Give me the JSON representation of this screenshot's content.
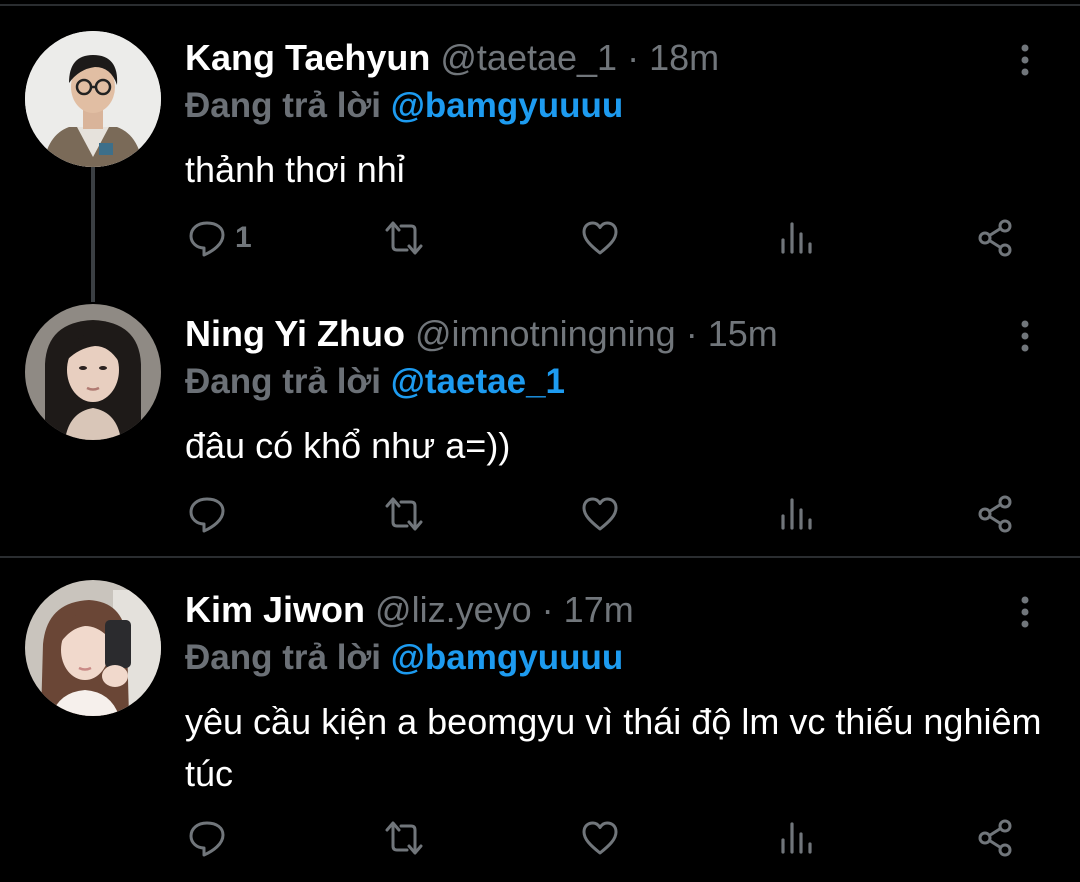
{
  "colors": {
    "background": "#000000",
    "name": "#ffffff",
    "muted": "#71767b",
    "mention": "#1d9bf0",
    "divider": "#2a2d30"
  },
  "tweets": [
    {
      "name": "Kang Taehyun",
      "handle": "@taetae_1",
      "separator": "·",
      "time": "18m",
      "reply_prefix": "Đang trả lời",
      "reply_to": "@bamgyuuuu",
      "text": "thảnh thơi nhỉ",
      "reply_count": "1",
      "icons": [
        "reply-icon",
        "retweet-icon",
        "like-icon",
        "views-icon",
        "share-icon",
        "more-options-icon"
      ]
    },
    {
      "name": "Ning Yi Zhuo",
      "handle": "@imnotningning",
      "separator": "·",
      "time": "15m",
      "reply_prefix": "Đang trả lời",
      "reply_to": "@taetae_1",
      "text": "đâu có khổ như a=))",
      "reply_count": "",
      "icons": [
        "reply-icon",
        "retweet-icon",
        "like-icon",
        "views-icon",
        "share-icon",
        "more-options-icon"
      ]
    },
    {
      "name": "Kim Jiwon",
      "handle": "@liz.yeyo",
      "separator": "·",
      "time": "17m",
      "reply_prefix": "Đang trả lời",
      "reply_to": "@bamgyuuuu",
      "text": "yêu cầu kiện a beomgyu vì thái độ lm vc thiếu nghiêm túc",
      "reply_count": "",
      "icons": [
        "reply-icon",
        "retweet-icon",
        "like-icon",
        "views-icon",
        "share-icon",
        "more-options-icon"
      ]
    }
  ]
}
